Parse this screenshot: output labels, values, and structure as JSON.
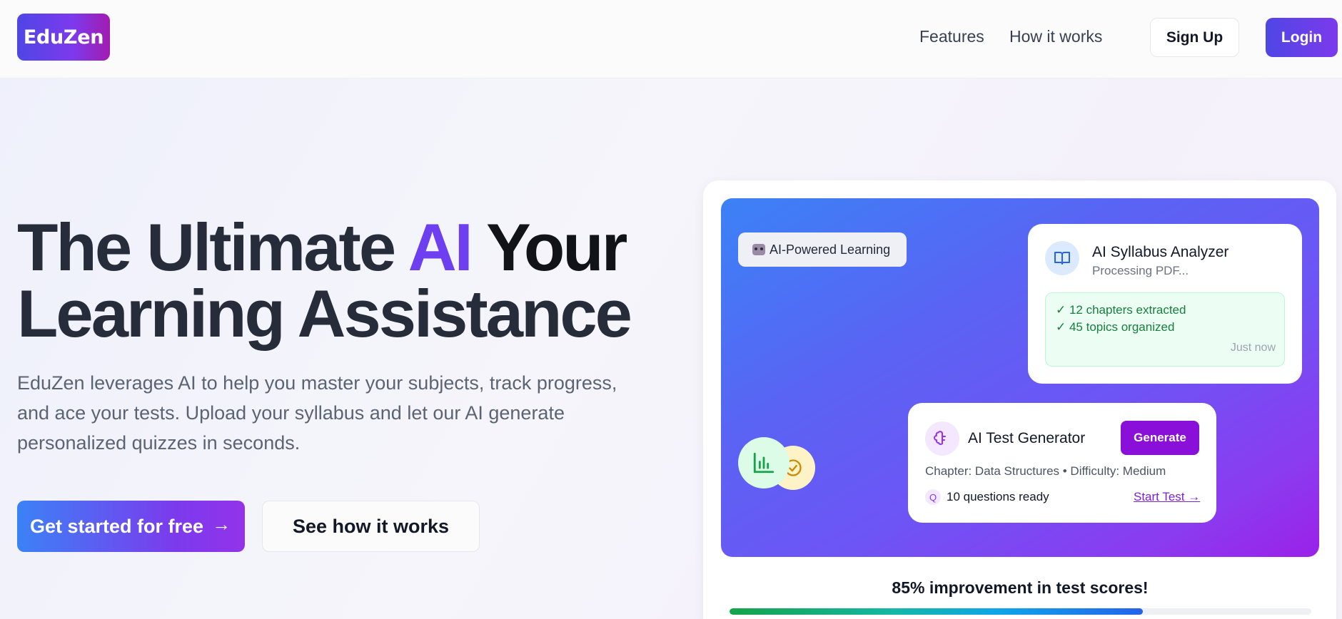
{
  "header": {
    "logo": "EduZen",
    "nav": {
      "features": "Features",
      "how_it_works": "How it works"
    },
    "signup_label": "Sign Up",
    "login_label": "Login"
  },
  "hero": {
    "title_part1": "The Ultimate ",
    "title_ai": "AI",
    "title_part2": " Your",
    "title_line2": "Learning Assistance",
    "description": "EduZen leverages AI to help you master your subjects, track progress, and ace your tests. Upload your syllabus and let our AI generate personalized quizzes in seconds.",
    "cta_primary": "Get started for free",
    "cta_secondary": "See how it works"
  },
  "panel": {
    "pill_label": "AI-Powered Learning",
    "syllabus": {
      "title": "AI Syllabus Analyzer",
      "subtitle": "Processing PDF...",
      "line1": "✓ 12 chapters extracted",
      "line2": "✓ 45 topics organized",
      "time": "Just now"
    },
    "test": {
      "title": "AI Test Generator",
      "generate_label": "Generate",
      "meta": "Chapter: Data Structures • Difficulty: Medium",
      "q_badge": "Q",
      "ready": "10 questions ready",
      "start_label": "Start Test →"
    },
    "improvement_text": "85% improvement in test scores!",
    "improvement_progress": 0.71
  },
  "colors": {
    "brand_start": "#4f46e5",
    "brand_end": "#7c3aed",
    "generate_button": "#8a0fd8",
    "success_green": "#15803d"
  },
  "icons": {
    "syllabus": "book-icon",
    "test": "brain-icon",
    "stats": "bar-chart-icon",
    "check": "check-circle-icon",
    "arrow": "arrow-right-icon",
    "pill": "robot-icon"
  }
}
